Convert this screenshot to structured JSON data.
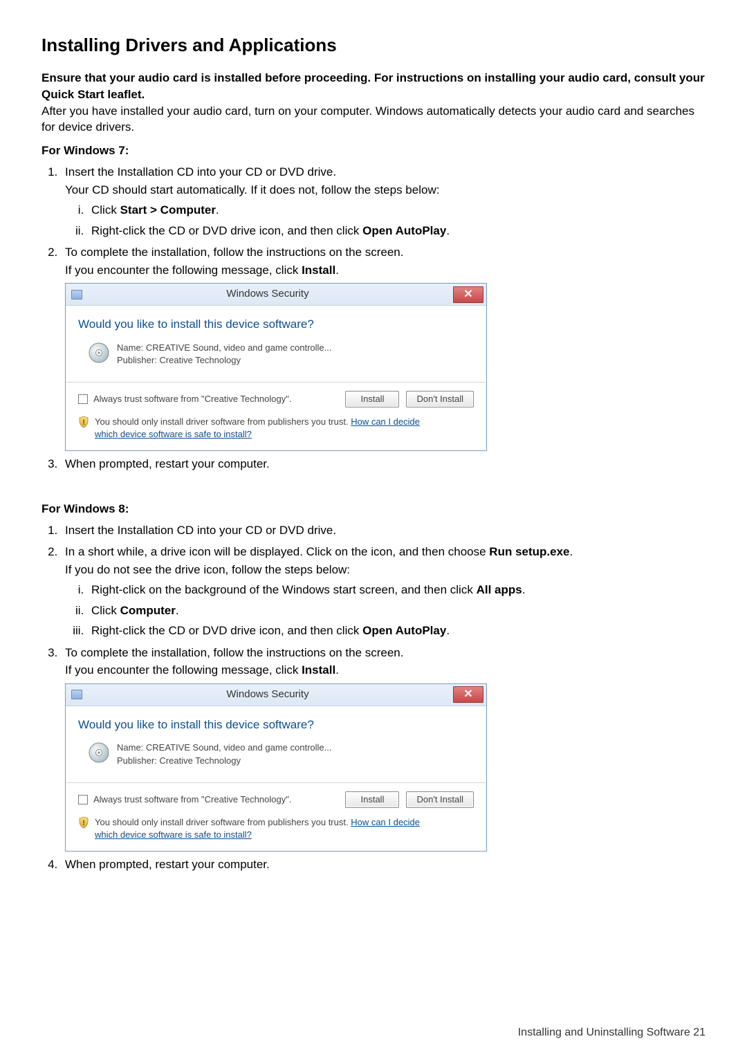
{
  "heading": "Installing Drivers and Applications",
  "intro_bold": "Ensure that your audio card is installed before proceeding. For instructions on installing your audio card, consult your Quick Start leaflet.",
  "intro": "After you have installed your audio card, turn on your computer. Windows automatically detects your audio card and searches for device drivers.",
  "win7": {
    "title": "For Windows 7:",
    "step1_a": "Insert the Installation CD into your CD or DVD drive.",
    "step1_b": "Your CD should start automatically. If it does not, follow the steps below:",
    "sub_i_pre": "Click ",
    "sub_i_bold": "Start > Computer",
    "sub_i_post": ".",
    "sub_ii_pre": "Right-click the CD or DVD drive icon, and then click ",
    "sub_ii_bold": "Open AutoPlay",
    "sub_ii_post": ".",
    "step2_a": "To complete the installation, follow the instructions on the screen.",
    "step2_b_pre": "If you encounter the following message, click ",
    "step2_b_bold": "Install",
    "step2_b_post": ".",
    "step3": "When prompted, restart your computer."
  },
  "win8": {
    "title": "For Windows 8:",
    "step1": "Insert the Installation CD into your CD or DVD drive.",
    "step2_a_pre": "In a short while, a drive icon will be displayed. Click on the icon, and then choose ",
    "step2_a_bold": "Run setup.exe",
    "step2_a_post": ".",
    "step2_b": "If you do not see the drive icon, follow the steps below:",
    "sub_i_pre": "Right-click on the background of the Windows start screen, and then click ",
    "sub_i_bold": "All apps",
    "sub_i_post": ".",
    "sub_ii_pre": "Click ",
    "sub_ii_bold": "Computer",
    "sub_ii_post": ".",
    "sub_iii_pre": "Right-click the CD or DVD drive icon, and then click ",
    "sub_iii_bold": "Open AutoPlay",
    "sub_iii_post": ".",
    "step3_a": "To complete the installation, follow the instructions on the screen.",
    "step3_b_pre": "If you encounter the following message, click ",
    "step3_b_bold": "Install",
    "step3_b_post": ".",
    "step4": "When prompted, restart your computer."
  },
  "dialog": {
    "title": "Windows Security",
    "question": "Would you like to install this device software?",
    "device_name": "Name: CREATIVE Sound, video and game controlle...",
    "publisher": "Publisher: Creative Technology",
    "trust_label": "Always trust software from \"Creative Technology\".",
    "install": "Install",
    "dont_install": "Don't Install",
    "info_text": "You should only install driver software from publishers you trust.  ",
    "info_link1": "How can I decide",
    "info_link2": "which device software is safe to install?"
  },
  "footer": "Installing and Uninstalling Software 21"
}
